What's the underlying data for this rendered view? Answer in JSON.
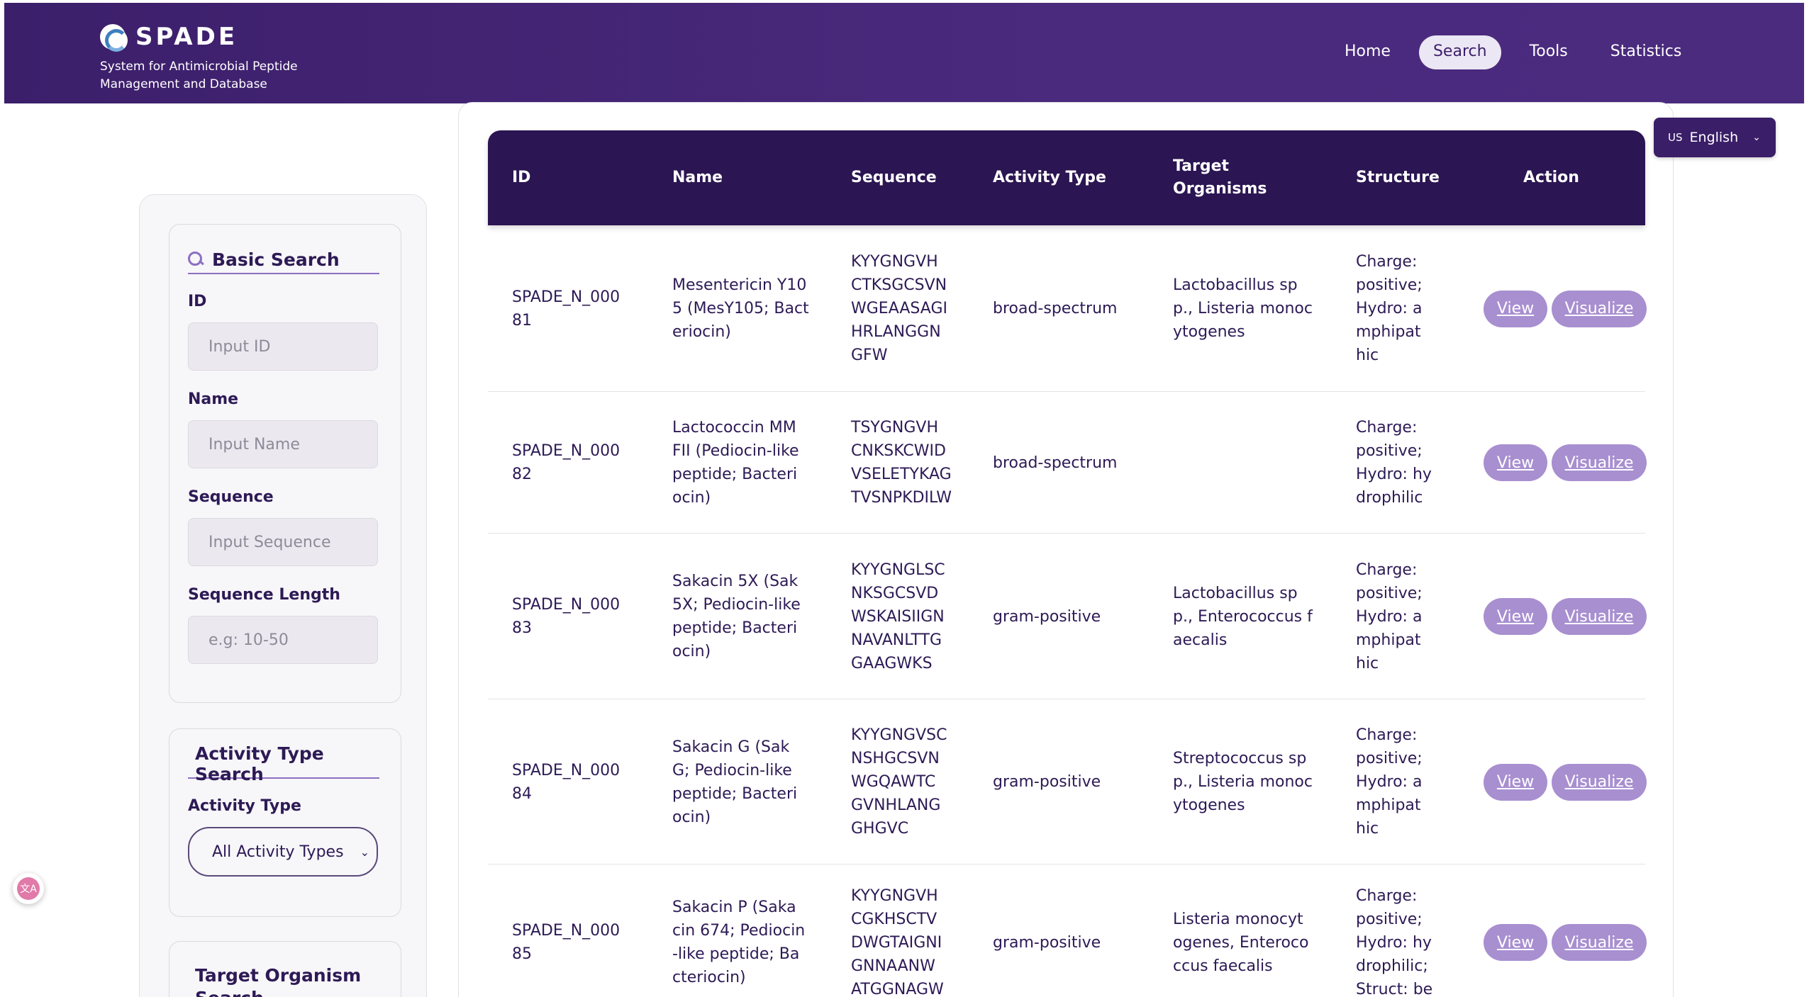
{
  "header": {
    "brand": "SPADE",
    "subtitle": "System for Antimicrobial Peptide Management and Database",
    "nav": [
      {
        "label": "Home",
        "active": false
      },
      {
        "label": "Search",
        "active": true
      },
      {
        "label": "Tools",
        "active": false
      },
      {
        "label": "Statistics",
        "active": false
      }
    ]
  },
  "language": {
    "flag": "US",
    "label": "English"
  },
  "sidebar": {
    "basic": {
      "title": "Basic Search",
      "fields": [
        {
          "label": "ID",
          "placeholder": "Input ID"
        },
        {
          "label": "Name",
          "placeholder": "Input Name"
        },
        {
          "label": "Sequence",
          "placeholder": "Input Sequence"
        },
        {
          "label": "Sequence Length",
          "placeholder": "e.g: 10-50"
        }
      ]
    },
    "activity": {
      "title": "Activity Type Search",
      "label": "Activity Type",
      "selected": "All Activity Types"
    },
    "target": {
      "title": "Target Organism Search"
    }
  },
  "table": {
    "headers": [
      "ID",
      "Name",
      "Sequence",
      "Activity Type",
      "Target Organisms",
      "Structure",
      "Action"
    ],
    "view_label": "View",
    "visualize_label": "Visualize",
    "rows": [
      {
        "id": [
          "SPADE_N_000",
          "81"
        ],
        "name": [
          "Mesentericin Y10",
          "5 (MesY105; Bact",
          "eriocin)"
        ],
        "sequence": [
          "KYYGNGVH",
          "CTKSGCSVN",
          "WGEAASAGI",
          "HRLANGGN",
          "GFW"
        ],
        "activity": "broad-spectrum",
        "target": [
          "Lactobacillus sp",
          "p., Listeria monoc",
          "ytogenes"
        ],
        "structure": [
          "Charge:",
          "positive;",
          "Hydro: a",
          "mphipat",
          "hic"
        ]
      },
      {
        "id": [
          "SPADE_N_000",
          "82"
        ],
        "name": [
          "Lactococcin MM",
          "FII (Pediocin-like",
          "peptide; Bacteri",
          "ocin)"
        ],
        "sequence": [
          "TSYGNGVH",
          "CNKSKCWID",
          "VSELETYKAG",
          "TVSNPKDILW"
        ],
        "activity": "broad-spectrum",
        "target": [],
        "structure": [
          "Charge:",
          "positive;",
          "Hydro: hy",
          "drophilic"
        ]
      },
      {
        "id": [
          "SPADE_N_000",
          "83"
        ],
        "name": [
          "Sakacin 5X (Sak",
          "5X; Pediocin-like",
          "peptide; Bacteri",
          "ocin)"
        ],
        "sequence": [
          "KYYGNGLSC",
          "NKSGCSVD",
          "WSKAISIIGN",
          "NAVANLTTG",
          "GAAGWKS"
        ],
        "activity": "gram-positive",
        "target": [
          "Lactobacillus sp",
          "p., Enterococcus f",
          "aecalis"
        ],
        "structure": [
          "Charge:",
          "positive;",
          "Hydro: a",
          "mphipat",
          "hic"
        ]
      },
      {
        "id": [
          "SPADE_N_000",
          "84"
        ],
        "name": [
          "Sakacin G (Sak",
          "G; Pediocin-like",
          "peptide; Bacteri",
          "ocin)"
        ],
        "sequence": [
          "KYYGNGVSC",
          "NSHGCSVN",
          "WGQAWTC",
          "GVNHLANG",
          "GHGVC"
        ],
        "activity": "gram-positive",
        "target": [
          "Streptococcus sp",
          "p., Listeria monoc",
          "ytogenes"
        ],
        "structure": [
          "Charge:",
          "positive;",
          "Hydro: a",
          "mphipat",
          "hic"
        ]
      },
      {
        "id": [
          "SPADE_N_000",
          "85"
        ],
        "name": [
          "Sakacin P (Saka",
          "cin 674; Pediocin",
          "-like peptide; Ba",
          "cteriocin)"
        ],
        "sequence": [
          "KYYGNGVH",
          "CGKHSCTV",
          "DWGTAIGNI",
          "GNNAANW",
          "ATGGNAGW"
        ],
        "activity": "gram-positive",
        "target": [
          "Listeria monocyt",
          "ogenes, Enteroco",
          "ccus faecalis"
        ],
        "structure": [
          "Charge:",
          "positive;",
          "Hydro: hy",
          "drophilic;",
          "Struct: be"
        ]
      }
    ]
  },
  "translate_badge": "文A"
}
